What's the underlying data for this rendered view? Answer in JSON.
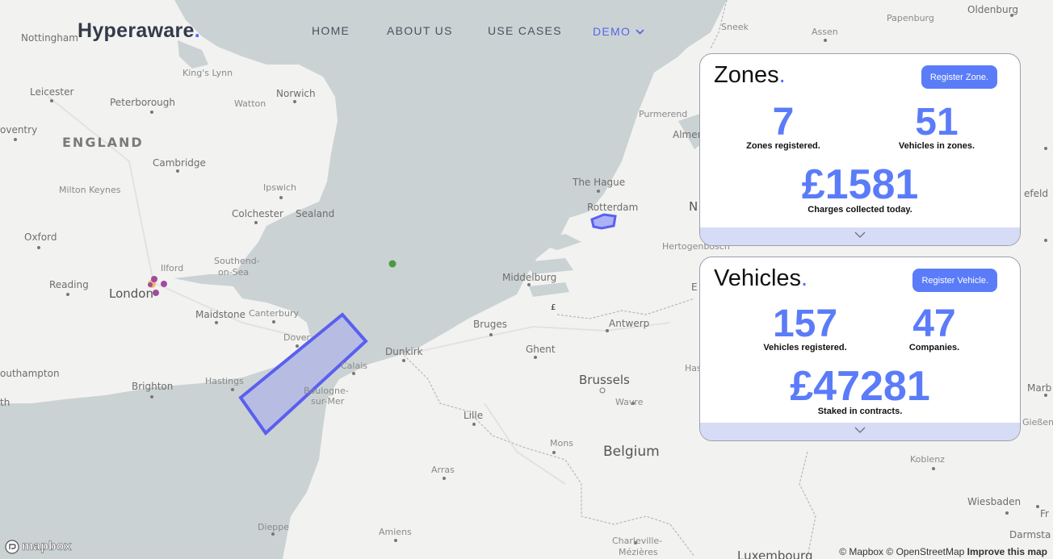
{
  "header": {
    "logo": "Hyperaware",
    "logo_dot": ".",
    "nav": [
      {
        "label": "HOME"
      },
      {
        "label": "ABOUT US"
      },
      {
        "label": "USE CASES"
      },
      {
        "label": "DEMO"
      }
    ]
  },
  "zones": {
    "title": "Zones",
    "dot": ".",
    "button": "Register Zone.",
    "stat1_value": "7",
    "stat1_label": "Zones registered.",
    "stat2_value": "51",
    "stat2_label": "Vehicles in zones.",
    "stat3_value": "£1581",
    "stat3_label": "Charges collected today."
  },
  "vehicles": {
    "title": "Vehicles",
    "dot": ".",
    "button": "Register Vehicle.",
    "stat1_value": "157",
    "stat1_label": "Vehicles registered.",
    "stat2_value": "47",
    "stat2_label": "Companies.",
    "stat3_value": "£47281",
    "stat3_label": "Staked in contracts."
  },
  "map": {
    "places": {
      "nottingham": "Nottingham",
      "kingslynn": "King's Lynn",
      "leicester": "Leicester",
      "peterborough": "Peterborough",
      "norwich": "Norwich",
      "watton": "Watton",
      "coventry": "oventry",
      "england": "ENGLAND",
      "cambridge": "Cambridge",
      "miltonkeynes": "Milton Keynes",
      "ipswich": "Ipswich",
      "colchester": "Colchester",
      "sealand": "Sealand",
      "oxford": "Oxford",
      "ilford": "Ilford",
      "southend1": "Southend-",
      "southend2": "on-Sea",
      "reading": "Reading",
      "london": "London",
      "maidstone": "Maidstone",
      "canterbury": "Canterbury",
      "dover": "Dover",
      "southampton": "outhampton",
      "brighton": "Brighton",
      "hastings": "Hastings",
      "calais": "Calais",
      "boulogne1": "Boulogne-",
      "boulogne2": "sur-Mer",
      "dunkirk": "Dunkirk",
      "bruges": "Bruges",
      "ghent": "Ghent",
      "antwerp": "Antwerp",
      "brussels": "Brussels",
      "wavre": "Wavre",
      "lille": "Lille",
      "mons": "Mons",
      "belgium": "Belgium",
      "arras": "Arras",
      "amiens": "Amiens",
      "dieppe": "Dieppe",
      "charleville1": "Charleville-",
      "charleville2": "Mézières",
      "luxembourg": "Luxembourg",
      "middelburg": "Middelburg",
      "thehague": "The Hague",
      "rotterdam": "Rotterdam",
      "hertogenbosch": "Hertogenbosch",
      "purmerend": "Purmerend",
      "almere": "Almer",
      "sneek": "Sneek",
      "assen": "Assen",
      "oldenburg": "Oldenburg",
      "papenburg": "Papenburg",
      "bielefeld": "efeld",
      "koblenz": "Koblenz",
      "wiesbaden": "Wiesbaden",
      "darmstadt": "Darmsta",
      "giessen": "Gießen",
      "marb": "Marb",
      "fr": "Fr",
      "has": "Has",
      "n": "N",
      "e": "E",
      "th": "th",
      "pound": "£"
    },
    "mapbox": "mapbox",
    "attribution_mapbox": "© Mapbox",
    "attribution_osm": "© OpenStreetMap",
    "attribution_improve": "Improve this map"
  },
  "colors": {
    "accent": "#5468ff",
    "button": "#5b7cf8",
    "zone_fill": "#b4b8e4",
    "zone_stroke": "#5a5ff0",
    "sea": "#cbd2d3",
    "land": "#f2f2f1"
  }
}
